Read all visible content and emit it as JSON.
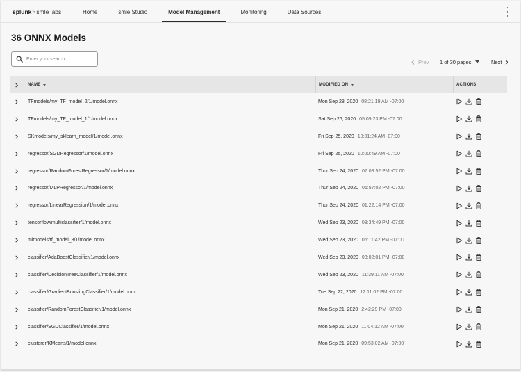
{
  "brand": {
    "name": "splunk",
    "sep": ">",
    "product": "smle labs"
  },
  "nav": {
    "tabs": [
      {
        "label": "Home"
      },
      {
        "label": "smle Studio"
      },
      {
        "label": "Model Management"
      },
      {
        "label": "Monitoring"
      },
      {
        "label": "Data Sources"
      }
    ],
    "active": "Model Management"
  },
  "page": {
    "title": "36 ONNX Models"
  },
  "search": {
    "placeholder": "Enter your search..."
  },
  "pagination": {
    "prev": "Prev",
    "pages": "1 of 30 pages",
    "next": "Next"
  },
  "table": {
    "headers": {
      "name": "NAME",
      "modified": "MODIFIED ON",
      "actions": "ACTIONS"
    },
    "rows": [
      {
        "name": "TFmodels/my_TF_model_2/1/model.onnx",
        "date": "Mon Sep 28, 2020",
        "time": "08:21:19 AM -07:00"
      },
      {
        "name": "TFmodels/my_TF_model_1/1/model.onnx",
        "date": "Sat Sep 26, 2020",
        "time": "05:09:23 PM -07:00"
      },
      {
        "name": "SKmodels/my_sklearn_model/1/model.onnx",
        "date": "Fri Sep 25, 2020",
        "time": "10:01:24 AM -07:00"
      },
      {
        "name": "regressor/SGDRegressor/1/model.onnx",
        "date": "Fri Sep 25, 2020",
        "time": "10:00:49 AM -07:00"
      },
      {
        "name": "regressor/RandomForestRegressor/1/model.onnx",
        "date": "Thur Sep 24, 2020",
        "time": "07:08:52 PM -07:00"
      },
      {
        "name": "regressor/MLPRegressor/1/model.onnx",
        "date": "Thur Sep 24, 2020",
        "time": "06:57:02 PM -07:00"
      },
      {
        "name": "regressor/LinearRegression/1/model.onnx",
        "date": "Thur Sep 24, 2020",
        "time": "01:22:14 PM -07:00"
      },
      {
        "name": "tensorflow/multiclassifier/1/model.onnx",
        "date": "Wed Sep 23, 2020",
        "time": "08:34:49 PM -07:00"
      },
      {
        "name": "mlmodels/tf_model_8/1/model.onnx",
        "date": "Wed Sep 23, 2020",
        "time": "06:11:42 PM -07:00"
      },
      {
        "name": "classifier/AdaBoostClassifier/1/model.onnx",
        "date": "Wed Sep 23, 2020",
        "time": "03:02:01 PM -07:00"
      },
      {
        "name": "classifier/DecisionTreeClassifier/1/model.onnx",
        "date": "Wed Sep 23, 2020",
        "time": "11:39:11 AM -07:00"
      },
      {
        "name": "classifier/GradientBoostingClassifier/1/model.onnx",
        "date": "Tue Sep 22, 2020",
        "time": "12:11:02 PM -07:00"
      },
      {
        "name": "classifier/RandomForestClassifier/1/model.onnx",
        "date": "Mon Sep 21, 2020",
        "time": "2:42:29 PM -07:00"
      },
      {
        "name": "classifier/SGDClassifier/1/model.onnx",
        "date": "Mon Sep 21, 2020",
        "time": "11:04:12 AM -07:00"
      },
      {
        "name": "clusterer/KMeans/1/model.onnx",
        "date": "Mon Sep 21, 2020",
        "time": "09:53:02 AM -07:00"
      }
    ]
  },
  "icons": {
    "expand": "chevron-right-icon",
    "run": "play-icon",
    "download": "download-icon",
    "delete": "trash-icon",
    "search": "search-icon",
    "menu": "kebab-menu-icon"
  }
}
